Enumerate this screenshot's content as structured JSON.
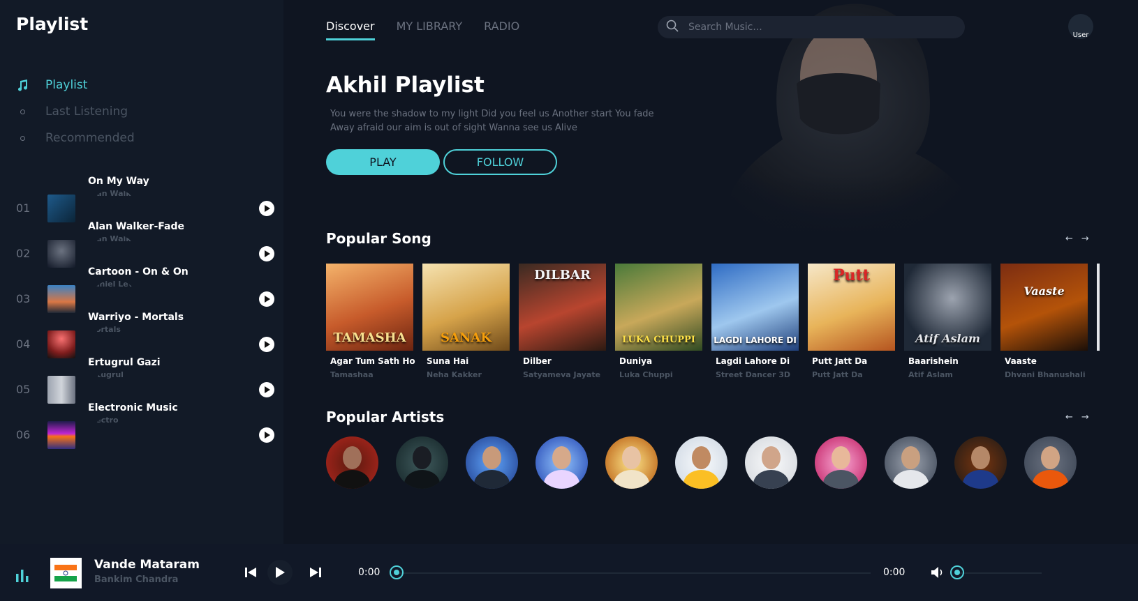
{
  "sidebar": {
    "app_title": "Playlist",
    "nav": [
      {
        "label": "Playlist",
        "icon": "music-note-icon",
        "active": true
      },
      {
        "label": "Last Listening",
        "icon": "dot-icon",
        "active": false
      },
      {
        "label": "Recommended",
        "icon": "dot-icon",
        "active": false
      }
    ],
    "songs": [
      {
        "num": "01",
        "title": "On My Way",
        "artist": "Alan Walker"
      },
      {
        "num": "02",
        "title": "Alan Walker-Fade",
        "artist": "Alan Walker"
      },
      {
        "num": "03",
        "title": "Cartoon - On & On",
        "artist": "Daniel Levi"
      },
      {
        "num": "04",
        "title": "Warriyo - Mortals",
        "artist": "Mortals"
      },
      {
        "num": "05",
        "title": "Ertugrul Gazi",
        "artist": "Ertugrul"
      },
      {
        "num": "06",
        "title": "Electronic Music",
        "artist": "Electro"
      }
    ]
  },
  "header": {
    "tabs": [
      {
        "label": "Discover",
        "active": true
      },
      {
        "label": "MY LIBRARY",
        "active": false
      },
      {
        "label": "RADIO",
        "active": false
      }
    ],
    "search_placeholder": "Search Music...",
    "avatar_alt": "User"
  },
  "hero": {
    "title": "Akhil Playlist",
    "description": "You were the shadow to my light Did you feel us Another start You fade Away afraid our aim is out of sight Wanna see us Alive",
    "play_label": "PLAY",
    "follow_label": "FOLLOW"
  },
  "popular_songs": {
    "title": "Popular Song",
    "prev": "←",
    "next": "→",
    "items": [
      {
        "title": "Agar Tum Sath Ho",
        "artist": "Tamashaa",
        "cover_text": "TAMASHA"
      },
      {
        "title": "Suna Hai",
        "artist": "Neha Kakker",
        "cover_text": "SANAK"
      },
      {
        "title": "Dilber",
        "artist": "Satyameva Jayate",
        "cover_text": "DILBAR"
      },
      {
        "title": "Duniya",
        "artist": "Luka Chuppi",
        "cover_text": "LUKA CHUPPI"
      },
      {
        "title": "Lagdi Lahore Di",
        "artist": "Street Dancer 3D",
        "cover_text": "LAGDI LAHORE DI"
      },
      {
        "title": "Putt Jatt Da",
        "artist": "Putt Jatt Da",
        "cover_text": "Putt"
      },
      {
        "title": "Baarishein",
        "artist": "Atif Aslam",
        "cover_text": "Atif Aslam"
      },
      {
        "title": "Vaaste",
        "artist": "Dhvani Bhanushali",
        "cover_text": "Vaaste"
      }
    ]
  },
  "popular_artists": {
    "title": "Popular Artists",
    "prev": "←",
    "next": "→"
  },
  "player": {
    "title": "Vande Mataram",
    "artist": "Bankim Chandra",
    "current_time": "0:00",
    "duration": "0:00",
    "progress": 0
  },
  "colors": {
    "accent": "#4fd1d9",
    "background": "#0f1521",
    "sidebar": "#121a27"
  }
}
